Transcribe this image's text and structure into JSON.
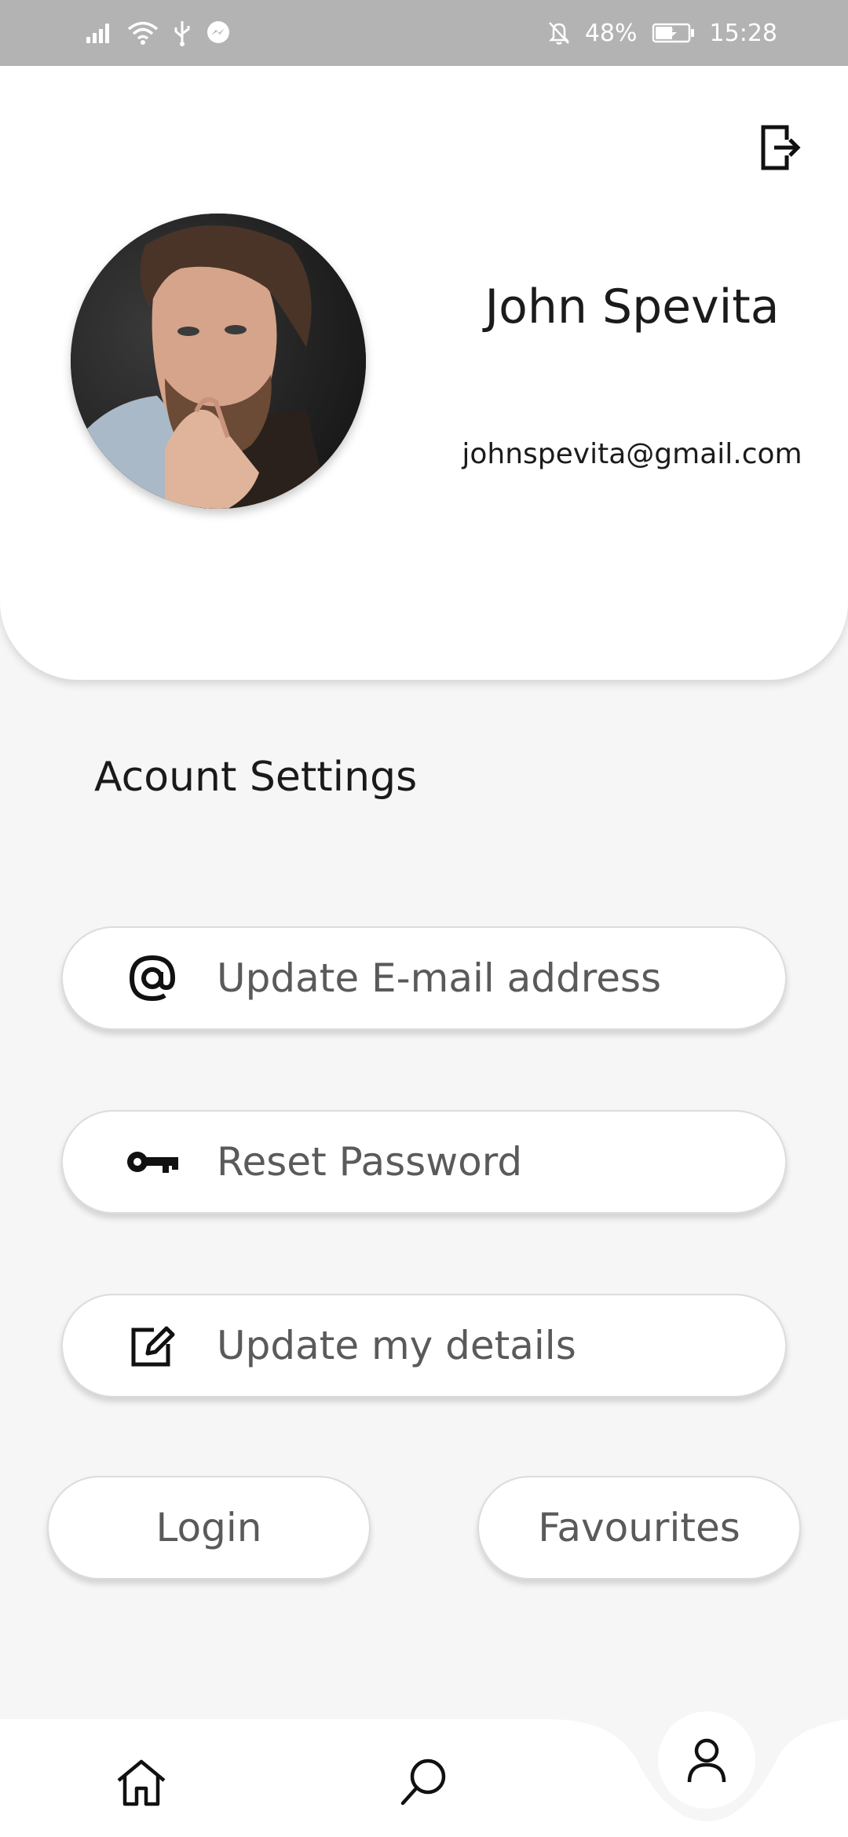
{
  "status_bar": {
    "battery_percent": "48%",
    "time": "15:28",
    "icons_left": [
      "signal-icon",
      "wifi-icon",
      "usb-icon",
      "messenger-icon"
    ],
    "icons_right": [
      "notifications-off-icon",
      "battery-icon"
    ]
  },
  "profile": {
    "name": "John Spevita",
    "email": "johnspevita@gmail.com",
    "logout_icon": "logout-icon"
  },
  "settings": {
    "title": "Acount Settings",
    "items": [
      {
        "label": "Update E-mail address",
        "icon": "at-sign-icon"
      },
      {
        "label": "Reset Password",
        "icon": "key-icon"
      },
      {
        "label": "Update my details",
        "icon": "edit-icon"
      }
    ],
    "login_label": "Login",
    "favourites_label": "Favourites"
  },
  "bottom_nav": {
    "items": [
      {
        "icon": "home-icon"
      },
      {
        "icon": "search-icon"
      },
      {
        "icon": "profile-icon",
        "active": true
      }
    ]
  },
  "colors": {
    "status_bar": "#b3b3b3",
    "background": "#f6f6f6",
    "card": "#ffffff",
    "button_text": "#5a5a5a"
  }
}
